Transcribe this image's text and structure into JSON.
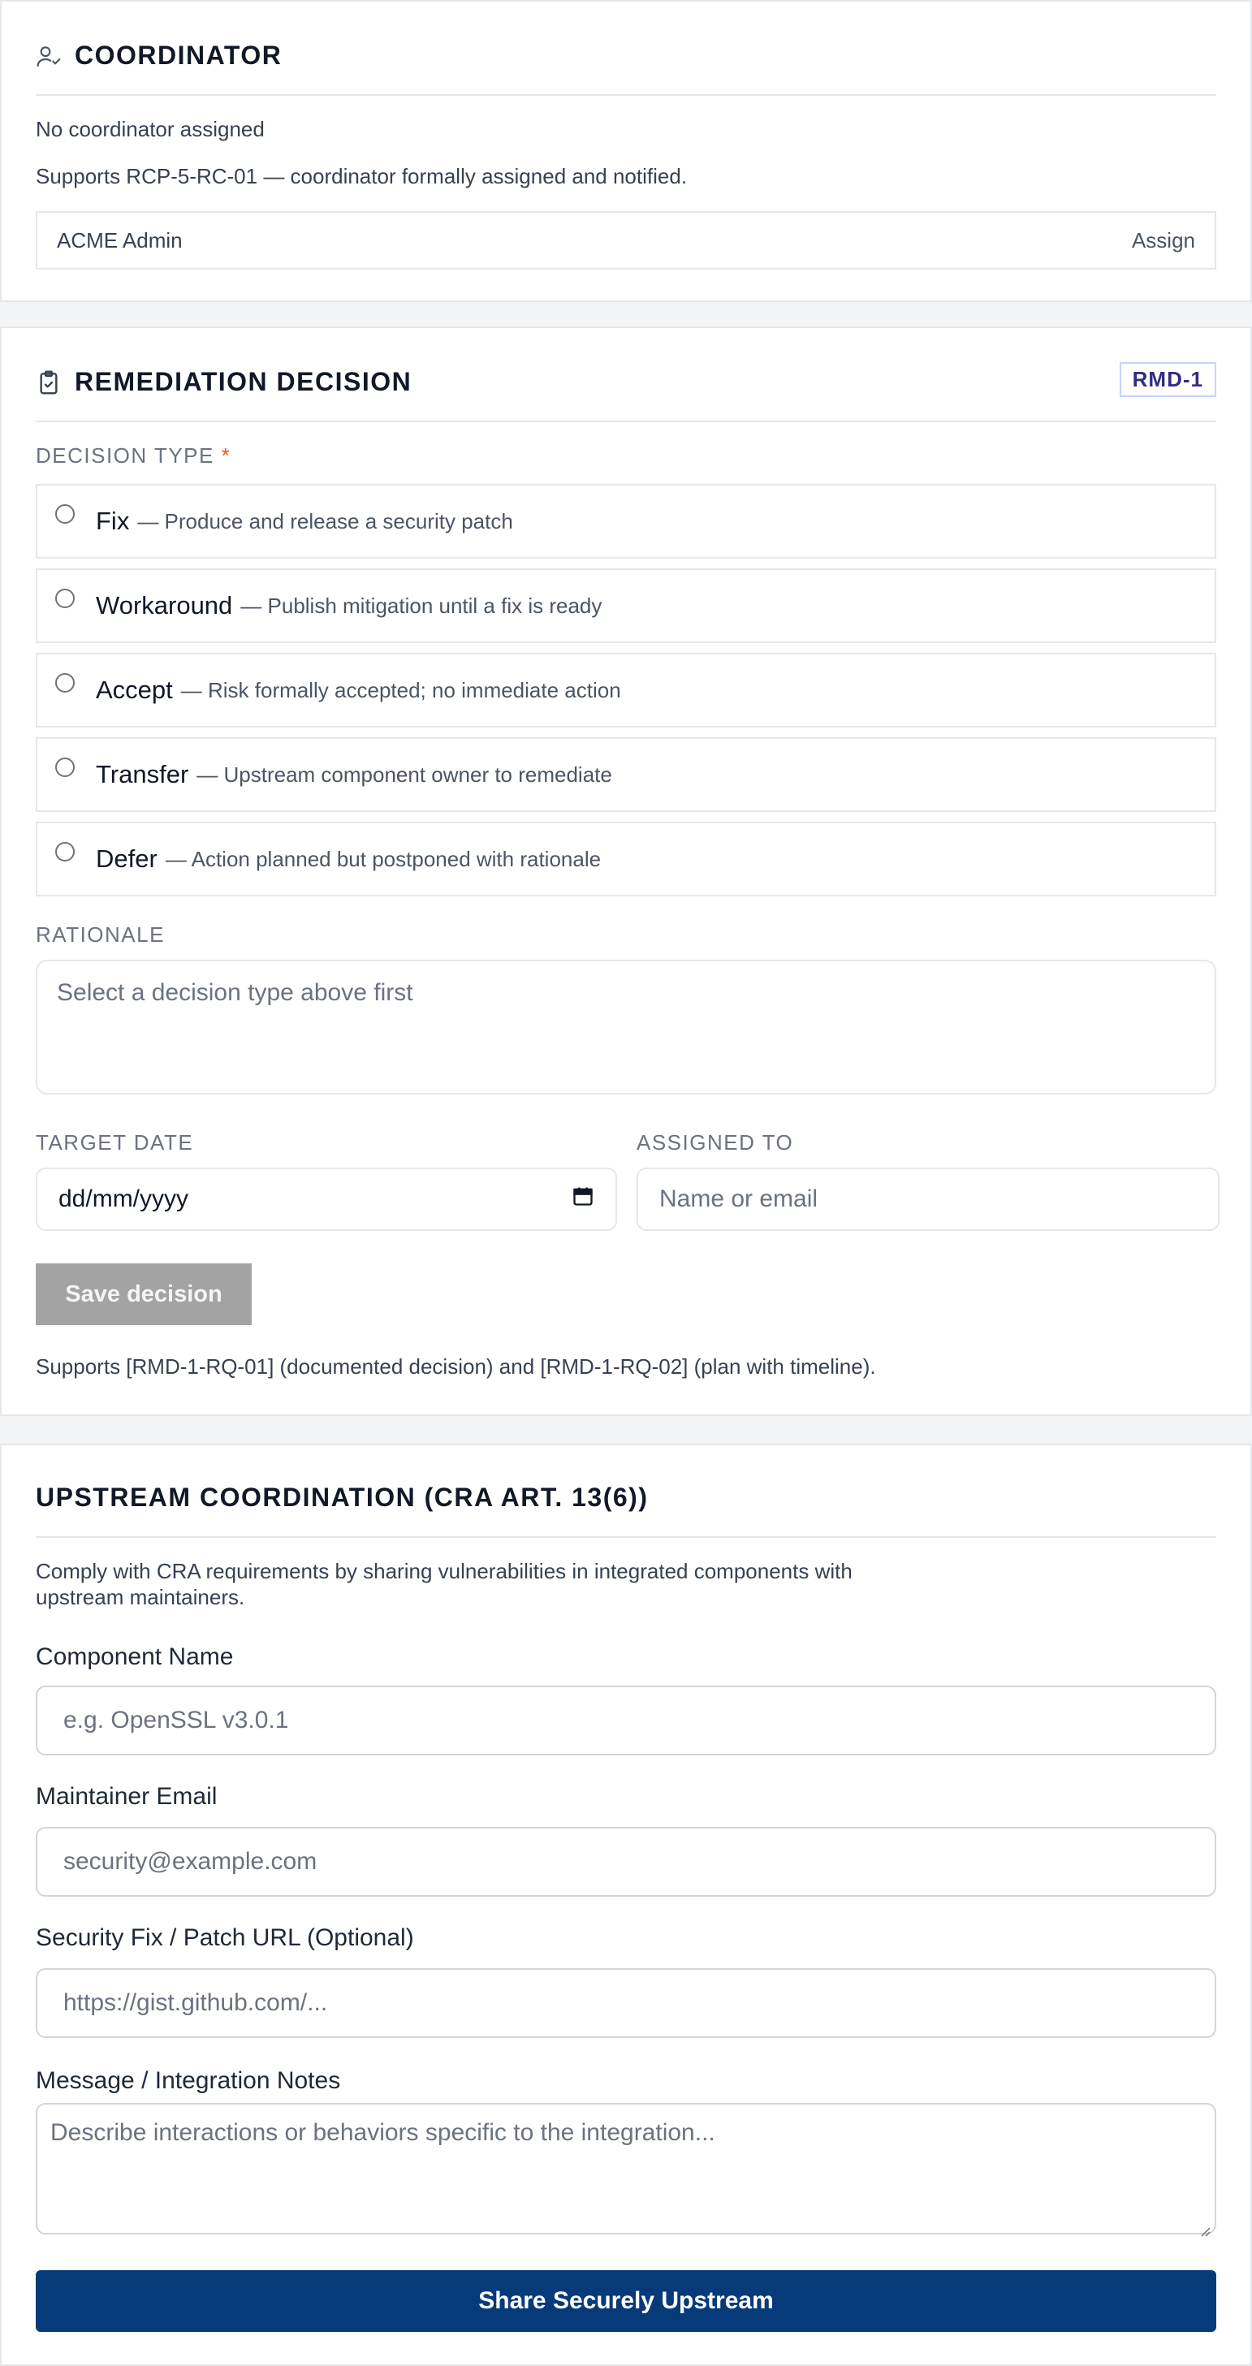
{
  "coordinator": {
    "title": "COORDINATOR",
    "status": "No coordinator assigned",
    "supports": "Supports RCP-5-RC-01 — coordinator formally assigned and notified.",
    "selected_user": "ACME Admin",
    "assign_label": "Assign"
  },
  "remediation": {
    "title": "REMEDIATION DECISION",
    "badge": "RMD-1",
    "decision_type_label": "DECISION TYPE",
    "required_marker": "*",
    "options": [
      {
        "label": "Fix",
        "desc": "— Produce and release a security patch"
      },
      {
        "label": "Workaround",
        "desc": "— Publish mitigation until a fix is ready"
      },
      {
        "label": "Accept",
        "desc": "— Risk formally accepted; no immediate action"
      },
      {
        "label": "Transfer",
        "desc": "— Upstream component owner to remediate"
      },
      {
        "label": "Defer",
        "desc": "— Action planned but postponed with rationale"
      }
    ],
    "rationale_label": "RATIONALE",
    "rationale_placeholder": "Select a decision type above first",
    "target_date_label": "TARGET DATE",
    "target_date_placeholder": "dd/mm/yyyy",
    "assigned_to_label": "ASSIGNED TO",
    "assigned_to_placeholder": "Name or email",
    "save_label": "Save decision",
    "supports": "Supports [RMD-1-RQ-01] (documented decision) and [RMD-1-RQ-02] (plan with timeline)."
  },
  "upstream": {
    "title": "UPSTREAM COORDINATION (CRA ART. 13(6))",
    "description_line1": "Comply with CRA requirements by sharing vulnerabilities in integrated components with",
    "description_line2": "upstream maintainers.",
    "component_label": "Component Name",
    "component_placeholder": "e.g. OpenSSL v3.0.1",
    "email_label": "Maintainer Email",
    "email_placeholder": "security@example.com",
    "patch_label": "Security Fix / Patch URL (Optional)",
    "patch_placeholder": "https://gist.github.com/...",
    "message_label": "Message / Integration Notes",
    "message_placeholder": "Describe interactions or behaviors specific to the integration...",
    "share_label": "Share Securely Upstream"
  },
  "colors": {
    "primary": "#073a79",
    "badge_text": "#312e81",
    "required": "#ea580c",
    "disabled_button": "#a3a3a3"
  }
}
